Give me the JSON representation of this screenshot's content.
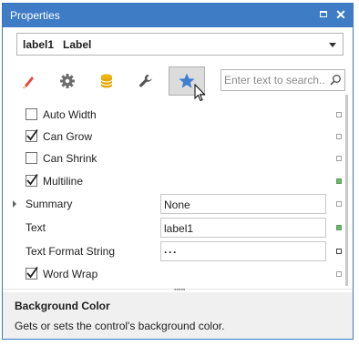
{
  "window": {
    "title": "Properties"
  },
  "selector": {
    "name": "label1",
    "type": "Label"
  },
  "tabs": [
    {
      "icon": "brush-icon"
    },
    {
      "icon": "gear-icon"
    },
    {
      "icon": "database-icon"
    },
    {
      "icon": "wrench-icon"
    },
    {
      "icon": "star-icon",
      "active": true
    }
  ],
  "search": {
    "placeholder": "Enter text to search..."
  },
  "properties": [
    {
      "label": "Auto Width",
      "kind": "checkbox",
      "checked": false
    },
    {
      "label": "Can Grow",
      "kind": "checkbox",
      "checked": true
    },
    {
      "label": "Can Shrink",
      "kind": "checkbox",
      "checked": false
    },
    {
      "label": "Multiline",
      "kind": "checkbox",
      "checked": true
    },
    {
      "label": "Summary",
      "kind": "field",
      "value": "None",
      "expandable": true
    },
    {
      "label": "Text",
      "kind": "field",
      "value": "label1"
    },
    {
      "label": "Text Format String",
      "kind": "field",
      "value": "",
      "button": "···"
    },
    {
      "label": "Word Wrap",
      "kind": "checkbox",
      "checked": true
    }
  ],
  "description": {
    "title": "Background Color",
    "text": "Gets or sets the control's background color."
  },
  "colors": {
    "accent": "#3e7cc5",
    "modified": "#6cb56c",
    "star": "#3f7fd0"
  }
}
